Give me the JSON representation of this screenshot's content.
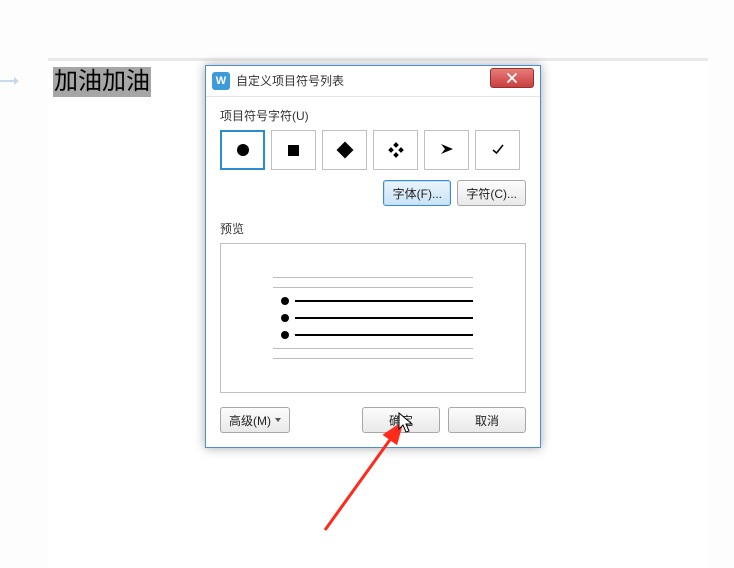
{
  "document": {
    "selected_text": "加油加油"
  },
  "dialog": {
    "title": "自定义项目符号列表",
    "section_bullet_label": "项目符号字符(U)",
    "bullets": [
      {
        "name": "bullet-dot-filled"
      },
      {
        "name": "bullet-square"
      },
      {
        "name": "bullet-diamond"
      },
      {
        "name": "bullet-fourdot"
      },
      {
        "name": "bullet-arrowhead"
      },
      {
        "name": "bullet-check"
      }
    ],
    "font_button": "字体(F)...",
    "char_button": "字符(C)...",
    "preview_label": "预览",
    "advanced_button": "高级(M)",
    "ok_button": "确定",
    "cancel_button": "取消"
  }
}
